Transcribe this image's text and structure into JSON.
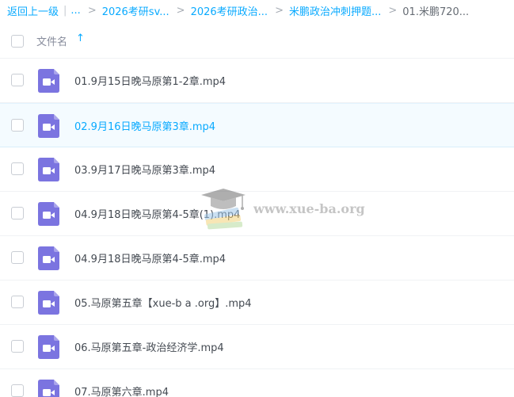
{
  "breadcrumb": {
    "back_label": "返回上一级",
    "pipe": "|",
    "ellipsis": "...",
    "separator": ">",
    "items": [
      {
        "label": "2026考研sv..."
      },
      {
        "label": "2026考研政治..."
      },
      {
        "label": "米鹏政治冲刺押题..."
      }
    ],
    "current": "01.米鹏720..."
  },
  "header": {
    "column_label": "文件名",
    "sort_icon": "sort-ascending-arrow",
    "sort_glyph": "↑"
  },
  "files": [
    {
      "name": "01.9月15日晚马原第1-2章.mp4",
      "icon": "video-file-icon",
      "selected": false
    },
    {
      "name": "02.9月16日晚马原第3章.mp4",
      "icon": "video-file-icon",
      "selected": true
    },
    {
      "name": "03.9月17日晚马原第3章.mp4",
      "icon": "video-file-icon",
      "selected": false
    },
    {
      "name": "04.9月18日晚马原第4-5章(1).mp4",
      "icon": "video-file-icon",
      "selected": false
    },
    {
      "name": "04.9月18日晚马原第4-5章.mp4",
      "icon": "video-file-icon",
      "selected": false
    },
    {
      "name": "05.马原第五章【xue-b a .org】.mp4",
      "icon": "video-file-icon",
      "selected": false
    },
    {
      "name": "06.马原第五章-政治经济学.mp4",
      "icon": "video-file-icon",
      "selected": false
    },
    {
      "name": "07.马原第六章.mp4",
      "icon": "video-file-icon",
      "selected": false
    }
  ],
  "watermark": {
    "text": "www.xue-ba.org"
  },
  "colors": {
    "link": "#09aaff",
    "video_icon": "#7b74e0",
    "selected_row_bg": "#f4fbff",
    "text": "#444a52"
  }
}
